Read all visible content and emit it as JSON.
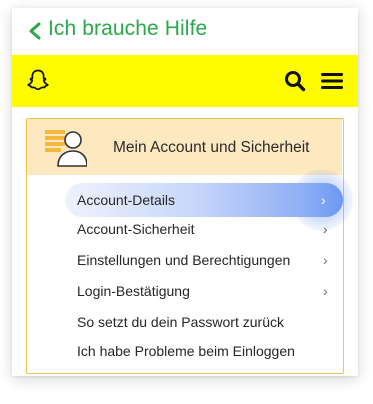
{
  "header": {
    "back_label": "Ich brauche Hilfe"
  },
  "topbar": {
    "logo_icon": "snapchat-ghost-icon",
    "search_icon": "search-icon",
    "menu_icon": "hamburger-menu-icon",
    "background": "#fffc00"
  },
  "section": {
    "title": "Mein Account und Sicherheit",
    "icon": "account-list-icon",
    "items": [
      {
        "label": "Account-Details",
        "chevron": "›",
        "active": true
      },
      {
        "label": "Account-Sicherheit",
        "chevron": "›"
      },
      {
        "label": "Einstellungen und Berechtigungen",
        "chevron": "›"
      },
      {
        "label": "Login-Bestätigung",
        "chevron": "›"
      },
      {
        "label": "So setzt du dein Passwort zurück",
        "chevron": ""
      },
      {
        "label": "Ich habe Probleme beim Einloggen",
        "chevron": ""
      }
    ]
  },
  "colors": {
    "accent_green": "#2aa84a",
    "panel_border": "#f0c44c",
    "panel_header": "#fde8c0",
    "highlight_blue": "#6c97f2"
  }
}
